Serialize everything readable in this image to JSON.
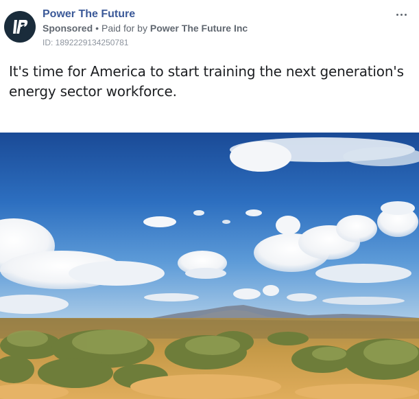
{
  "ad": {
    "page_name": "Power The Future",
    "sponsored_label": "Sponsored",
    "separator": "•",
    "paid_for_prefix": "Paid for by",
    "paid_for_entity": "Power The Future Inc",
    "id_text": "ID: 1892229134250781",
    "body_text": "It's time for America to start training the next generation's energy sector workforce.",
    "more_icon": "ellipsis-icon",
    "avatar_icon": "power-the-future-logo",
    "image_subject": "desert-landscape-with-mountains-and-clouds"
  },
  "colors": {
    "page_name": "#3b5998",
    "secondary_text": "#606770",
    "avatar_bg": "#1a2c3b",
    "sky_top": "#1d4f9c",
    "desert": "#d9a85a"
  }
}
